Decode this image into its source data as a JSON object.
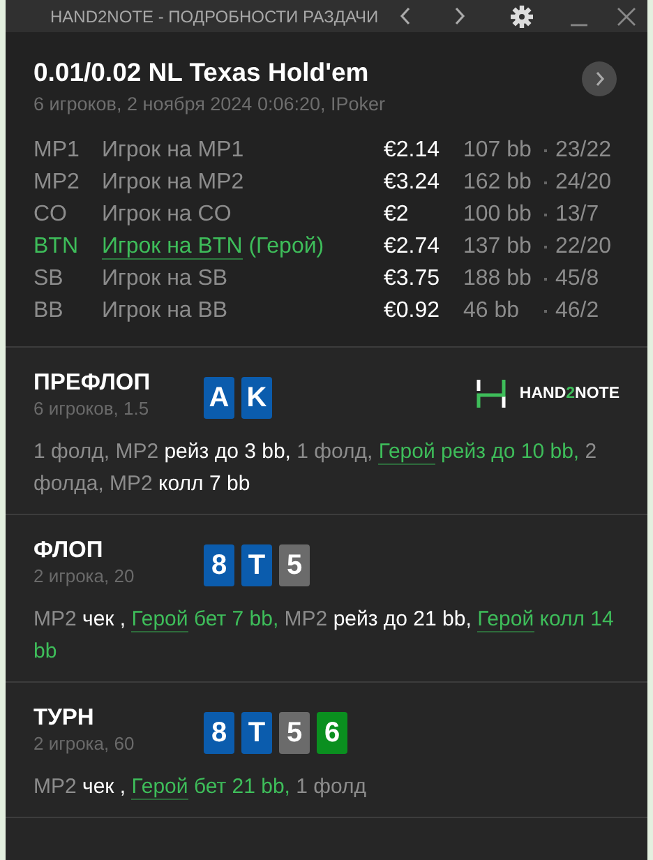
{
  "window": {
    "title": "HAND2NOTE - ПОДРОБНОСТИ РАЗДАЧИ"
  },
  "header": {
    "title": "0.01/0.02 NL Texas Hold'em",
    "subtitle": "6 игроков, 2 ноября 2024 0:06:20, IPoker"
  },
  "players": [
    {
      "position": "MP1",
      "name": "Игрок на MP1",
      "hero": false,
      "stack": "€2.14",
      "bb": "107 bb",
      "stats": "23/22"
    },
    {
      "position": "MP2",
      "name": "Игрок на MP2",
      "hero": false,
      "stack": "€3.24",
      "bb": "162 bb",
      "stats": "24/20"
    },
    {
      "position": "CO",
      "name": "Игрок на CO",
      "hero": false,
      "stack": "€2",
      "bb": "100 bb",
      "stats": "13/7"
    },
    {
      "position": "BTN",
      "name": "Игрок на BTN",
      "hero": true,
      "hero_tag": "(Герой)",
      "stack": "€2.74",
      "bb": "137 bb",
      "stats": "22/20"
    },
    {
      "position": "SB",
      "name": "Игрок на SB",
      "hero": false,
      "stack": "€3.75",
      "bb": "188 bb",
      "stats": "45/8"
    },
    {
      "position": "BB",
      "name": "Игрок на BB",
      "hero": false,
      "stack": "€0.92",
      "bb": "46 bb",
      "stats": "46/2"
    }
  ],
  "streets": [
    {
      "title": "ПРЕФЛОП",
      "subtitle": "6 игроков, 1.5",
      "cards": [
        {
          "rank": "A",
          "color": "#0b5cad"
        },
        {
          "rank": "K",
          "color": "#0b5cad"
        }
      ],
      "logo": [
        "HAND",
        "2",
        "NOTE"
      ],
      "actions": [
        {
          "kind": "muted",
          "text": "1 фолд, MP2 "
        },
        {
          "kind": "bright",
          "text": "рейз до 3 bb,"
        },
        {
          "kind": "muted",
          "text": " 1 фолд, "
        },
        {
          "kind": "hero_name",
          "text": "Герой"
        },
        {
          "kind": "hero",
          "text": " рейз до 10 bb,"
        },
        {
          "kind": "muted",
          "text": " 2 фолда, MP2 "
        },
        {
          "kind": "bright",
          "text": "колл 7 bb"
        }
      ]
    },
    {
      "title": "ФЛОП",
      "subtitle": "2 игрока, 20",
      "cards": [
        {
          "rank": "8",
          "color": "#0b5cad"
        },
        {
          "rank": "T",
          "color": "#0b5cad"
        },
        {
          "rank": "5",
          "color": "#6b6b6b"
        }
      ],
      "actions": [
        {
          "kind": "muted",
          "text": "MP2 "
        },
        {
          "kind": "bright",
          "text": "чек , "
        },
        {
          "kind": "hero_name",
          "text": "Герой"
        },
        {
          "kind": "hero",
          "text": " бет 7 bb,"
        },
        {
          "kind": "muted",
          "text": " MP2 "
        },
        {
          "kind": "bright",
          "text": "рейз до 21 bb, "
        },
        {
          "kind": "hero_name",
          "text": "Герой"
        },
        {
          "kind": "hero",
          "text": " колл 14 bb"
        }
      ]
    },
    {
      "title": "ТУРН",
      "subtitle": "2 игрока, 60",
      "cards": [
        {
          "rank": "8",
          "color": "#0b5cad"
        },
        {
          "rank": "T",
          "color": "#0b5cad"
        },
        {
          "rank": "5",
          "color": "#6b6b6b"
        },
        {
          "rank": "6",
          "color": "#0a8f1f"
        }
      ],
      "actions": [
        {
          "kind": "muted",
          "text": "MP2 "
        },
        {
          "kind": "bright",
          "text": "чек , "
        },
        {
          "kind": "hero_name",
          "text": "Герой"
        },
        {
          "kind": "hero",
          "text": " бет 21 bb,"
        },
        {
          "kind": "muted",
          "text": " 1 фолд"
        }
      ]
    }
  ]
}
